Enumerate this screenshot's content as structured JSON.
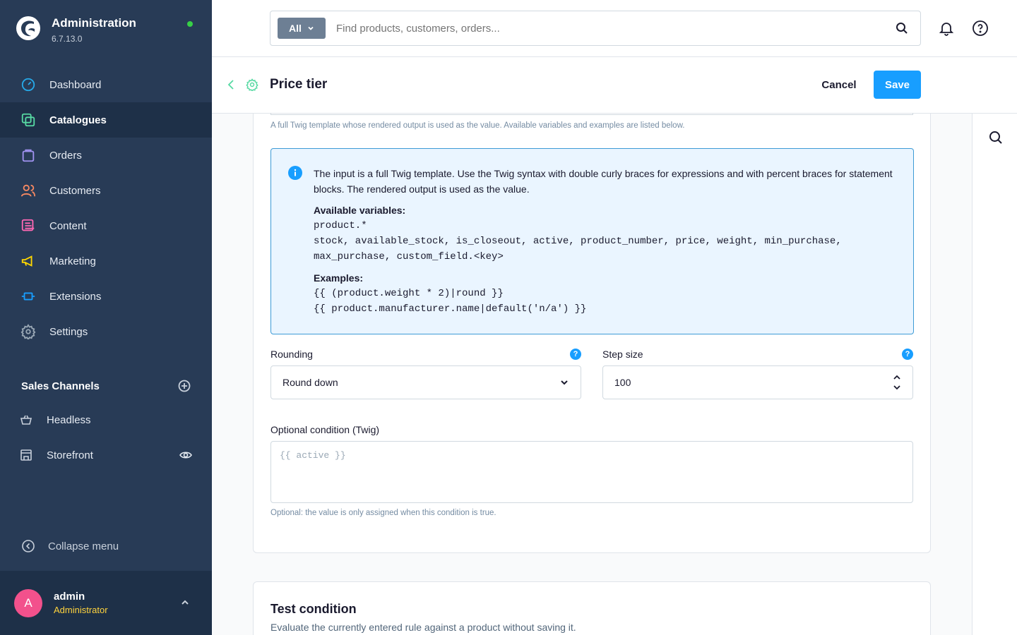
{
  "brand": {
    "title": "Administration",
    "version": "6.7.13.0"
  },
  "nav": [
    {
      "label": "Dashboard",
      "icon": "dashboard-icon",
      "color": "#26a9e8"
    },
    {
      "label": "Catalogues",
      "icon": "catalogue-icon",
      "color": "#57d9a3"
    },
    {
      "label": "Orders",
      "icon": "orders-icon",
      "color": "#a092f0"
    },
    {
      "label": "Customers",
      "icon": "customers-icon",
      "color": "#f88962"
    },
    {
      "label": "Content",
      "icon": "content-icon",
      "color": "#ff68b4"
    },
    {
      "label": "Marketing",
      "icon": "marketing-icon",
      "color": "#ffd700"
    },
    {
      "label": "Extensions",
      "icon": "extensions-icon",
      "color": "#189eff"
    },
    {
      "label": "Settings",
      "icon": "settings-icon",
      "color": "#9aa8b5"
    }
  ],
  "sales_channels": {
    "title": "Sales Channels",
    "items": [
      {
        "label": "Headless",
        "icon": "basket-icon"
      },
      {
        "label": "Storefront",
        "icon": "storefront-icon"
      }
    ]
  },
  "collapse_label": "Collapse menu",
  "user": {
    "initial": "A",
    "name": "admin",
    "role": "Administrator"
  },
  "search": {
    "scope": "All",
    "placeholder": "Find products, customers, orders..."
  },
  "page": {
    "title": "Price tier",
    "cancel": "Cancel",
    "save": "Save"
  },
  "template_help": "A full Twig template whose rendered output is used as the value. Available variables and examples are listed below.",
  "info": {
    "text": "The input is a full Twig template. Use the Twig syntax with double curly braces for expressions and with percent braces for statement blocks. The rendered output is used as the value.",
    "variables_label": "Available variables:",
    "variables_line1": "product.*",
    "variables_line2": "stock, available_stock, is_closeout, active, product_number, price, weight, min_purchase,",
    "variables_line3": "max_purchase, custom_field.<key>",
    "examples_label": "Examples:",
    "example1": "{{ (product.weight * 2)|round }}",
    "example2": "{{ product.manufacturer.name|default('n/a') }}"
  },
  "rounding": {
    "label": "Rounding",
    "value": "Round down"
  },
  "step_size": {
    "label": "Step size",
    "value": "100"
  },
  "condition": {
    "label": "Optional condition (Twig)",
    "placeholder": "{{ active }}",
    "help": "Optional: the value is only assigned when this condition is true."
  },
  "test": {
    "title": "Test condition",
    "subtitle": "Evaluate the currently entered rule against a product without saving it."
  }
}
